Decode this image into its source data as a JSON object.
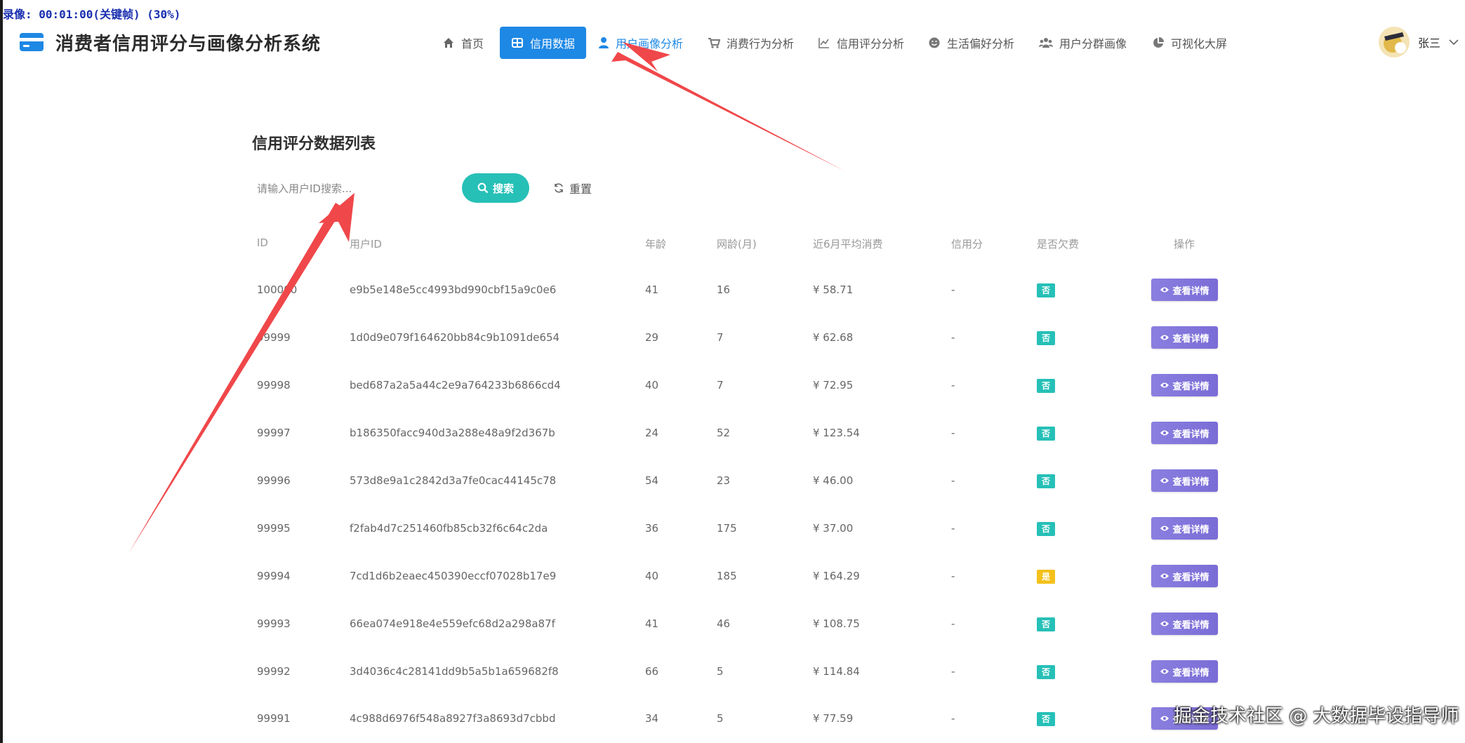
{
  "overlay": {
    "rec_text": "录像: 00:01:00(关键帧) (30%)"
  },
  "header": {
    "app_title": "消费者信用评分与画像分析系统",
    "nav": [
      {
        "label": "首页",
        "icon": "home-icon"
      },
      {
        "label": "信用数据",
        "icon": "table-icon",
        "active": true
      },
      {
        "label": "用户画像分析",
        "icon": "user-icon"
      },
      {
        "label": "消费行为分析",
        "icon": "cart-icon"
      },
      {
        "label": "信用评分分析",
        "icon": "line-chart-icon"
      },
      {
        "label": "生活偏好分析",
        "icon": "smile-icon"
      },
      {
        "label": "用户分群画像",
        "icon": "users-icon"
      },
      {
        "label": "可视化大屏",
        "icon": "pie-chart-icon"
      }
    ],
    "user_name": "张三"
  },
  "main": {
    "list_title": "信用评分数据列表",
    "search": {
      "placeholder": "请输入用户ID搜索...",
      "value": "",
      "button_label": "搜索"
    },
    "reset_label": "重置",
    "columns": [
      "ID",
      "用户ID",
      "年龄",
      "网龄(月)",
      "近6月平均消费",
      "信用分",
      "是否欠费",
      "操作"
    ],
    "detail_label": "查看详情",
    "rows": [
      {
        "id": "100000",
        "user_id": "e9b5e148e5cc4993bd990cbf15a9c0e6",
        "age": "41",
        "net_age": "16",
        "avg_spend": "¥ 58.71",
        "credit_score": "-",
        "arrears": "否"
      },
      {
        "id": "99999",
        "user_id": "1d0d9e079f164620bb84c9b1091de654",
        "age": "29",
        "net_age": "7",
        "avg_spend": "¥ 62.68",
        "credit_score": "-",
        "arrears": "否"
      },
      {
        "id": "99998",
        "user_id": "bed687a2a5a44c2e9a764233b6866cd4",
        "age": "40",
        "net_age": "7",
        "avg_spend": "¥ 72.95",
        "credit_score": "-",
        "arrears": "否"
      },
      {
        "id": "99997",
        "user_id": "b186350facc940d3a288e48a9f2d367b",
        "age": "24",
        "net_age": "52",
        "avg_spend": "¥ 123.54",
        "credit_score": "-",
        "arrears": "否"
      },
      {
        "id": "99996",
        "user_id": "573d8e9a1c2842d3a7fe0cac44145c78",
        "age": "54",
        "net_age": "23",
        "avg_spend": "¥ 46.00",
        "credit_score": "-",
        "arrears": "否"
      },
      {
        "id": "99995",
        "user_id": "f2fab4d7c251460fb85cb32f6c64c2da",
        "age": "36",
        "net_age": "175",
        "avg_spend": "¥ 37.00",
        "credit_score": "-",
        "arrears": "否"
      },
      {
        "id": "99994",
        "user_id": "7cd1d6b2eaec450390eccf07028b17e9",
        "age": "40",
        "net_age": "185",
        "avg_spend": "¥ 164.29",
        "credit_score": "-",
        "arrears": "是"
      },
      {
        "id": "99993",
        "user_id": "66ea074e918e4e559efc68d2a298a87f",
        "age": "41",
        "net_age": "46",
        "avg_spend": "¥ 108.75",
        "credit_score": "-",
        "arrears": "否"
      },
      {
        "id": "99992",
        "user_id": "3d4036c4c28141dd9b5a5b1a659682f8",
        "age": "66",
        "net_age": "5",
        "avg_spend": "¥ 114.84",
        "credit_score": "-",
        "arrears": "否"
      },
      {
        "id": "99991",
        "user_id": "4c988d6976f548a8927f3a8693d7cbbd",
        "age": "34",
        "net_age": "5",
        "avg_spend": "¥ 77.59",
        "credit_score": "-",
        "arrears": "否"
      }
    ]
  },
  "watermark": "掘金技术社区 @ 大数据毕设指导师",
  "colors": {
    "primary": "#1e88e5",
    "teal": "#26c0b7",
    "purple": "#7a6cd6",
    "warning": "#f4c11b",
    "annotation_arrow": "#f0474a"
  }
}
